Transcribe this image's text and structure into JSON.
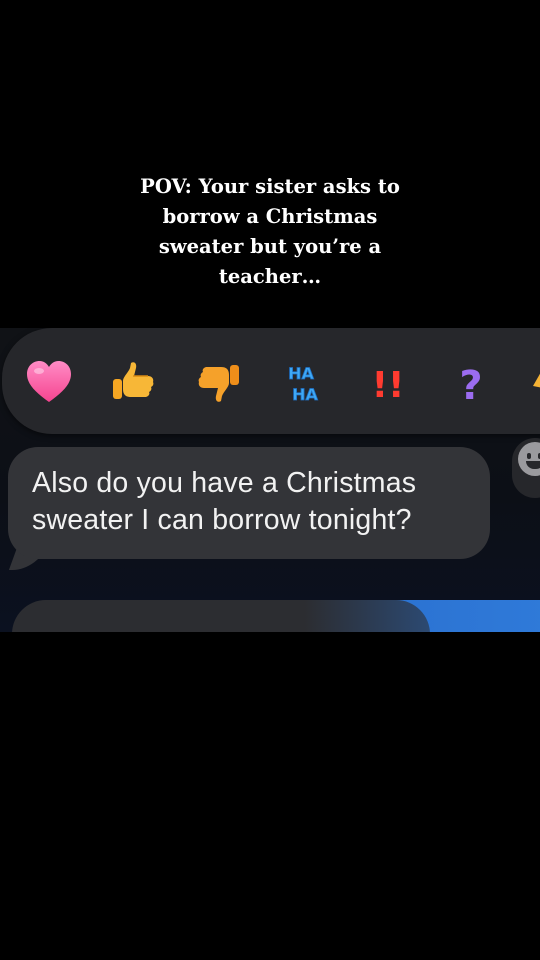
{
  "caption": {
    "text": "POV: Your sister asks to\nborrow a Christmas\nsweater but you’re a\nteacher…"
  },
  "reactions": [
    {
      "name": "heart",
      "icon": "heart-icon",
      "color": "#ff5fa8"
    },
    {
      "name": "thumbs-up",
      "icon": "thumbs-up-icon",
      "color": "#f5b335"
    },
    {
      "name": "thumbs-down",
      "icon": "thumbs-down-icon",
      "color": "#f5a02a"
    },
    {
      "name": "haha",
      "icon": "haha-icon",
      "label_top": "HA",
      "label_bottom": "HA",
      "color": "#3fa9f5"
    },
    {
      "name": "emphasize",
      "icon": "double-exclamation-icon",
      "label": "!!",
      "color": "#ff3b30"
    },
    {
      "name": "question",
      "icon": "question-mark-icon",
      "label": "?",
      "color": "#9b6cf0"
    }
  ],
  "message": {
    "line1": "Also do you have a Christmas",
    "line2": "sweater I can borrow tonight?"
  },
  "colors": {
    "background": "#000000",
    "incoming_bubble": "#333438",
    "reaction_bar": "#26272b",
    "outgoing_bubble": "#2f7ad9"
  }
}
